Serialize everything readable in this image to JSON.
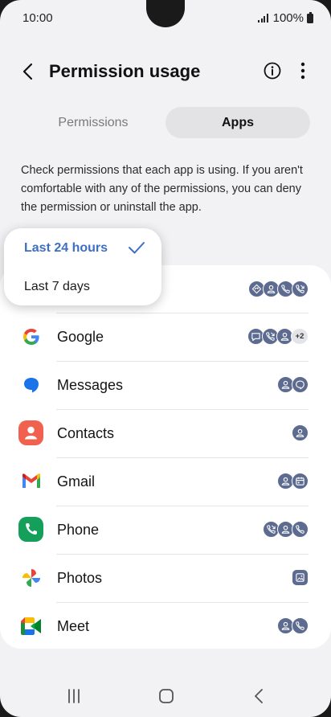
{
  "status_bar": {
    "time": "10:00",
    "battery": "100%"
  },
  "header": {
    "title": "Permission usage"
  },
  "tabs": [
    {
      "label": "Permissions",
      "selected": false
    },
    {
      "label": "Apps",
      "selected": true
    }
  ],
  "description": "Check permissions that each app is using. If you aren't comfortable with any of the permissions, you can deny the permission or uninstall the app.",
  "time_filter": {
    "options": [
      {
        "label": "Last 24 hours",
        "selected": true
      },
      {
        "label": "Last 7 days",
        "selected": false
      }
    ]
  },
  "apps": [
    {
      "name": "",
      "permissions": [
        "location-icon",
        "contacts-icon",
        "phone-icon",
        "call-log-icon"
      ]
    },
    {
      "name": "Google",
      "permissions": [
        "microphone-icon",
        "call-log-icon",
        "contacts-icon"
      ],
      "extra_count": "+2"
    },
    {
      "name": "Messages",
      "permissions": [
        "contacts-icon",
        "sms-icon"
      ]
    },
    {
      "name": "Contacts",
      "permissions": [
        "contacts-icon"
      ]
    },
    {
      "name": "Gmail",
      "permissions": [
        "contacts-icon",
        "calendar-icon"
      ]
    },
    {
      "name": "Phone",
      "permissions": [
        "call-log-icon",
        "contacts-icon",
        "phone-icon"
      ]
    },
    {
      "name": "Photos",
      "permissions": [
        "photos-icon"
      ]
    },
    {
      "name": "Meet",
      "permissions": [
        "contacts-icon",
        "phone-icon"
      ]
    }
  ],
  "colors": {
    "accent": "#3d6fc4",
    "permission_badge": "#5c6b8f",
    "card": "#ffffff",
    "background": "#f2f2f4"
  }
}
